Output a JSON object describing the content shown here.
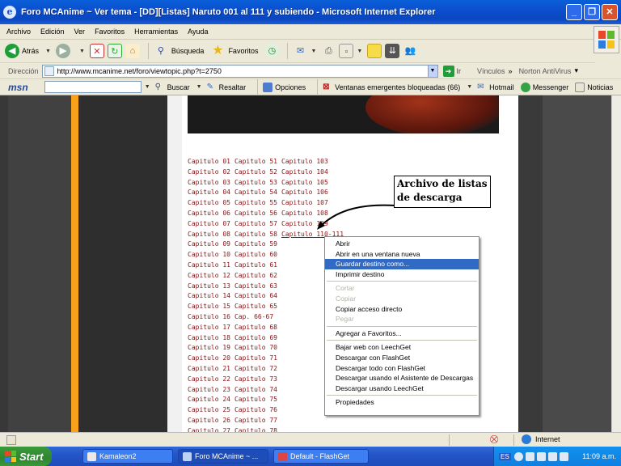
{
  "window": {
    "title": "Foro MCAnime ~ Ver tema - [DD][Listas] Naruto 001 al 111 y subiendo - Microsoft Internet Explorer"
  },
  "menu": [
    "Archivo",
    "Edición",
    "Ver",
    "Favoritos",
    "Herramientas",
    "Ayuda"
  ],
  "toolbar": {
    "back_label": "Atrás",
    "search_label": "Búsqueda",
    "favorites_label": "Favoritos"
  },
  "address": {
    "label": "Dirección",
    "url": "http://www.mcanime.net/foro/viewtopic.php?t=2750",
    "go_label": "Ir",
    "links_label": "Vínculos",
    "norton_label": "Norton AntiVirus"
  },
  "msnbar": {
    "logo": "msn",
    "search_label": "Buscar",
    "highlight_label": "Resaltar",
    "options_label": "Opciones",
    "popups_label": "Ventanas emergentes bloqueadas (66)",
    "hotmail_label": "Hotmail",
    "messenger_label": "Messenger",
    "news_label": "Noticias"
  },
  "chapters": [
    [
      "Capitulo 01",
      "Capitulo 51",
      "Capitulo 103"
    ],
    [
      "Capitulo 02",
      "Capitulo 52",
      "Capitulo 104"
    ],
    [
      "Capitulo 03",
      "Capitulo 53",
      "Capitulo 105"
    ],
    [
      "Capitulo 04",
      "Capitulo 54",
      "Capitulo 106"
    ],
    [
      "Capitulo 05",
      "Capitulo 55",
      "Capitulo 107"
    ],
    [
      "Capitulo 06",
      "Capitulo 56",
      "Capitulo 108"
    ],
    [
      "Capitulo 07",
      "Capitulo 57",
      "Capitulo 109"
    ],
    [
      "Capitulo 08",
      "Capitulo 58",
      "Capitulo 110-111"
    ],
    [
      "Capitulo 09",
      "Capitulo 59"
    ],
    [
      "Capitulo 10",
      "Capitulo 60"
    ],
    [
      "Capitulo 11",
      "Capitulo 61"
    ],
    [
      "Capitulo 12",
      "Capitulo 62"
    ],
    [
      "Capitulo 13",
      "Capitulo 63"
    ],
    [
      "Capitulo 14",
      "Capitulo 64"
    ],
    [
      "Capitulo 15",
      "Capitulo 65"
    ],
    [
      "Capitulo 16",
      "Cap. 66-67"
    ],
    [
      "Capitulo 17",
      "Capitulo 68"
    ],
    [
      "Capitulo 18",
      "Capitulo 69"
    ],
    [
      "Capitulo 19",
      "Capitulo 70"
    ],
    [
      "Capitulo 20",
      "Capitulo 71"
    ],
    [
      "Capitulo 21",
      "Capitulo 72"
    ],
    [
      "Capitulo 22",
      "Capitulo 73"
    ],
    [
      "Capitulo 23",
      "Capitulo 74"
    ],
    [
      "Capitulo 24",
      "Capitulo 75"
    ],
    [
      "Capitulo 25",
      "Capitulo 76"
    ],
    [
      "Capitulo 26",
      "Capitulo 77"
    ],
    [
      "Capitulo 27",
      "Capitulo 78"
    ]
  ],
  "callout": {
    "line1": "Archivo de listas",
    "line2": "de descarga"
  },
  "context_menu": [
    {
      "label": "Abrir",
      "state": "normal"
    },
    {
      "label": "Abrir en una ventana nueva",
      "state": "normal"
    },
    {
      "label": "Guardar destino como...",
      "state": "highlighted"
    },
    {
      "label": "Imprimir destino",
      "state": "normal"
    },
    {
      "sep": true
    },
    {
      "label": "Cortar",
      "state": "disabled"
    },
    {
      "label": "Copiar",
      "state": "disabled"
    },
    {
      "label": "Copiar acceso directo",
      "state": "normal"
    },
    {
      "label": "Pegar",
      "state": "disabled"
    },
    {
      "sep": true
    },
    {
      "label": "Agregar a Favoritos...",
      "state": "normal"
    },
    {
      "sep": true
    },
    {
      "label": "Bajar web con LeechGet",
      "state": "normal"
    },
    {
      "label": "Descargar con FlashGet",
      "state": "normal"
    },
    {
      "label": "Descargar todo con FlashGet",
      "state": "normal"
    },
    {
      "label": "Descargar usando el Asistente de Descargas",
      "state": "normal"
    },
    {
      "label": "Descargar usando LeechGet",
      "state": "normal"
    },
    {
      "sep": true
    },
    {
      "label": "Propiedades",
      "state": "normal"
    }
  ],
  "status": {
    "zone": "Internet"
  },
  "taskbar": {
    "start_label": "Start",
    "tasks": [
      "Kamaleon2",
      "Foro MCAnime ~ ...",
      "Default - FlashGet"
    ],
    "lang": "ES",
    "clock": "11:09 a.m."
  }
}
